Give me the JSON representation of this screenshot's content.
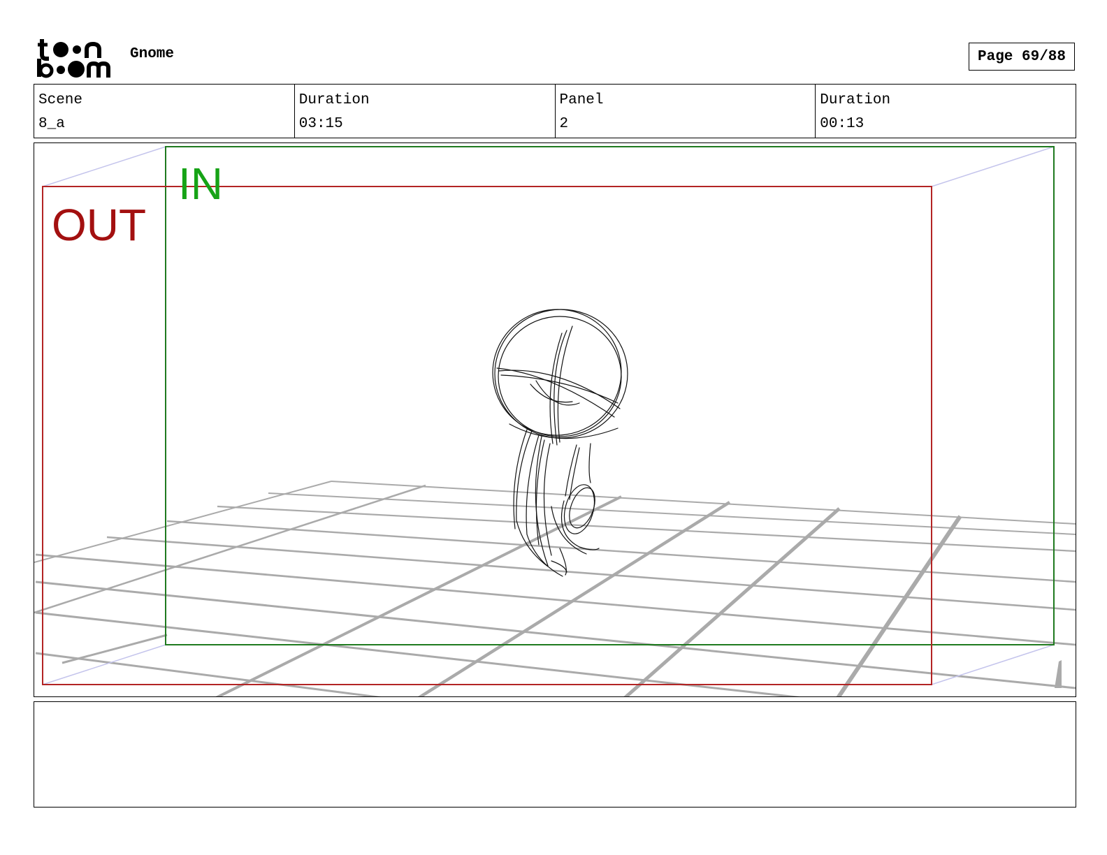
{
  "header": {
    "project_title": "Gnome",
    "page_label": "Page 69/88"
  },
  "info": {
    "scene_label": "Scene",
    "scene_value": "8_a",
    "scene_duration_label": "Duration",
    "scene_duration_value": "03:15",
    "panel_label": "Panel",
    "panel_value": "2",
    "panel_duration_label": "Duration",
    "panel_duration_value": "00:13"
  },
  "panel": {
    "in_label": "IN",
    "out_label": "OUT",
    "in_color": "#16a316",
    "out_color": "#a31010"
  },
  "dialog": {
    "text": ""
  },
  "logo": {
    "icon": "toonboom-logo-icon"
  }
}
